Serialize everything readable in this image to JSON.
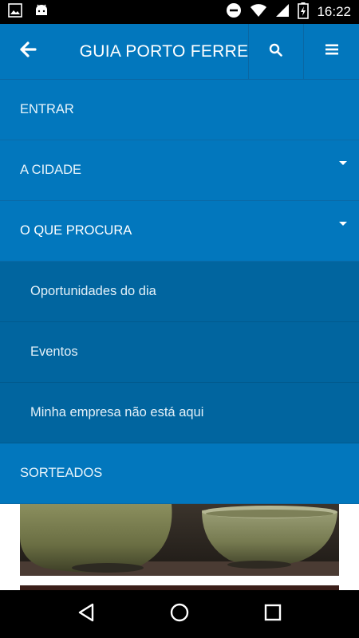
{
  "status_bar": {
    "time": "16:22",
    "left_icons": [
      "image-icon",
      "android-icon"
    ],
    "right_icons": [
      "do-not-disturb-icon",
      "wifi-icon",
      "signal-icon",
      "battery-charging-icon"
    ]
  },
  "app_bar": {
    "title": "GUIA PORTO FERREIRA",
    "back_icon": "arrow-left-icon",
    "search_icon": "search-icon",
    "menu_icon": "hamburger-menu-icon"
  },
  "menu": {
    "items": [
      {
        "label": "ENTRAR"
      },
      {
        "label": "A CIDADE",
        "has_dropdown": true
      },
      {
        "label": "O QUE PROCURA",
        "has_dropdown": true,
        "expanded": true
      },
      {
        "label": "SORTEADOS"
      }
    ],
    "submenu": [
      {
        "label": "Oportunidades do dia"
      },
      {
        "label": "Eventos"
      },
      {
        "label": "Minha empresa não está aqui"
      }
    ]
  },
  "colors": {
    "primary": "#0277bd",
    "submenu": "#01659f",
    "status_bar": "#000000"
  }
}
